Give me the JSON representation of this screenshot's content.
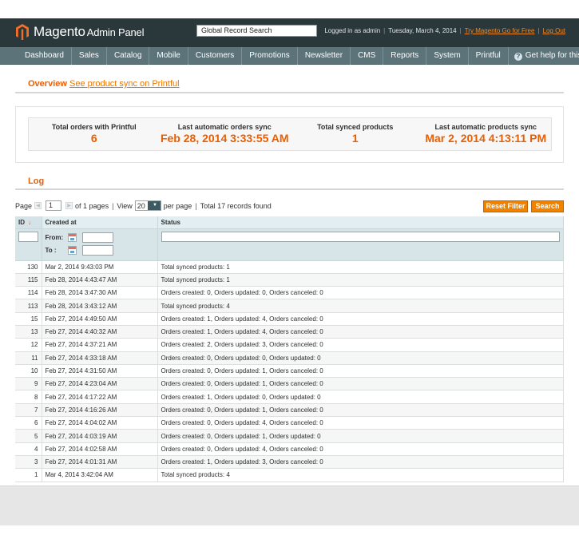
{
  "header": {
    "logo_main": "Magento",
    "logo_sub": "Admin Panel",
    "global_search": "Global Record Search",
    "logged_in": "Logged in as admin",
    "date": "Tuesday, March 4, 2014",
    "try_link": "Try Magento Go for Free",
    "logout_link": "Log Out",
    "sep": "|"
  },
  "nav": {
    "items": [
      "Dashboard",
      "Sales",
      "Catalog",
      "Mobile",
      "Customers",
      "Promotions",
      "Newsletter",
      "CMS",
      "Reports",
      "System",
      "Printful"
    ],
    "help": "Get help for this page"
  },
  "overview": {
    "title": "Overview",
    "link": "See product sync on Printful",
    "stats": [
      {
        "label": "Total orders with Printful",
        "value": "6"
      },
      {
        "label": "Last automatic orders sync",
        "value": "Feb 28, 2014 3:33:55 AM"
      },
      {
        "label": "Total synced products",
        "value": "1"
      },
      {
        "label": "Last automatic products sync",
        "value": "Mar 2, 2014 4:13:11 PM"
      }
    ]
  },
  "log": {
    "title": "Log",
    "pager": {
      "page_label": "Page",
      "page_value": "1",
      "of_pages": "of 1 pages",
      "view_label": "View",
      "view_value": "20",
      "per_page": "per page",
      "total": "Total 17 records found",
      "sep": "|"
    },
    "reset_filter": "Reset Filter",
    "search": "Search",
    "columns": {
      "id": "ID",
      "created": "Created at",
      "status": "Status"
    },
    "filter": {
      "from": "From:",
      "to": "To :"
    },
    "rows": [
      {
        "id": "130",
        "created": "Mar 2, 2014 9:43:03 PM",
        "status": "Total synced products: 1"
      },
      {
        "id": "115",
        "created": "Feb 28, 2014 4:43:47 AM",
        "status": "Total synced products: 1"
      },
      {
        "id": "114",
        "created": "Feb 28, 2014 3:47:30 AM",
        "status": "Orders created: 0, Orders updated: 0, Orders canceled: 0"
      },
      {
        "id": "113",
        "created": "Feb 28, 2014 3:43:12 AM",
        "status": "Total synced products: 4"
      },
      {
        "id": "15",
        "created": "Feb 27, 2014 4:49:50 AM",
        "status": "Orders created: 1, Orders updated: 4, Orders canceled: 0"
      },
      {
        "id": "13",
        "created": "Feb 27, 2014 4:40:32 AM",
        "status": "Orders created: 1, Orders updated: 4, Orders canceled: 0"
      },
      {
        "id": "12",
        "created": "Feb 27, 2014 4:37:21 AM",
        "status": "Orders created: 2, Orders updated: 3, Orders canceled: 0"
      },
      {
        "id": "11",
        "created": "Feb 27, 2014 4:33:18 AM",
        "status": "Orders created: 0, Orders updated: 0, Orders updated: 0"
      },
      {
        "id": "10",
        "created": "Feb 27, 2014 4:31:50 AM",
        "status": "Orders created: 0, Orders updated: 1, Orders canceled: 0"
      },
      {
        "id": "9",
        "created": "Feb 27, 2014 4:23:04 AM",
        "status": "Orders created: 0, Orders updated: 1, Orders canceled: 0"
      },
      {
        "id": "8",
        "created": "Feb 27, 2014 4:17:22 AM",
        "status": "Orders created: 1, Orders updated: 0, Orders updated: 0"
      },
      {
        "id": "7",
        "created": "Feb 27, 2014 4:16:26 AM",
        "status": "Orders created: 0, Orders updated: 1, Orders canceled: 0"
      },
      {
        "id": "6",
        "created": "Feb 27, 2014 4:04:02 AM",
        "status": "Orders created: 0, Orders updated: 4, Orders canceled: 0"
      },
      {
        "id": "5",
        "created": "Feb 27, 2014 4:03:19 AM",
        "status": "Orders created: 0, Orders updated: 1, Orders updated: 0"
      },
      {
        "id": "4",
        "created": "Feb 27, 2014 4:02:58 AM",
        "status": "Orders created: 0, Orders updated: 4, Orders canceled: 0"
      },
      {
        "id": "3",
        "created": "Feb 27, 2014 4:01:31 AM",
        "status": "Orders created: 1, Orders updated: 3, Orders canceled: 0"
      },
      {
        "id": "1",
        "created": "Mar 4, 2014 3:42:04 AM",
        "status": "Total synced products: 4"
      }
    ]
  },
  "colors": {
    "accent": "#eb5e00",
    "header_bg": "#2b383b",
    "nav_bg": "#5c7379",
    "button": "#f18200"
  }
}
